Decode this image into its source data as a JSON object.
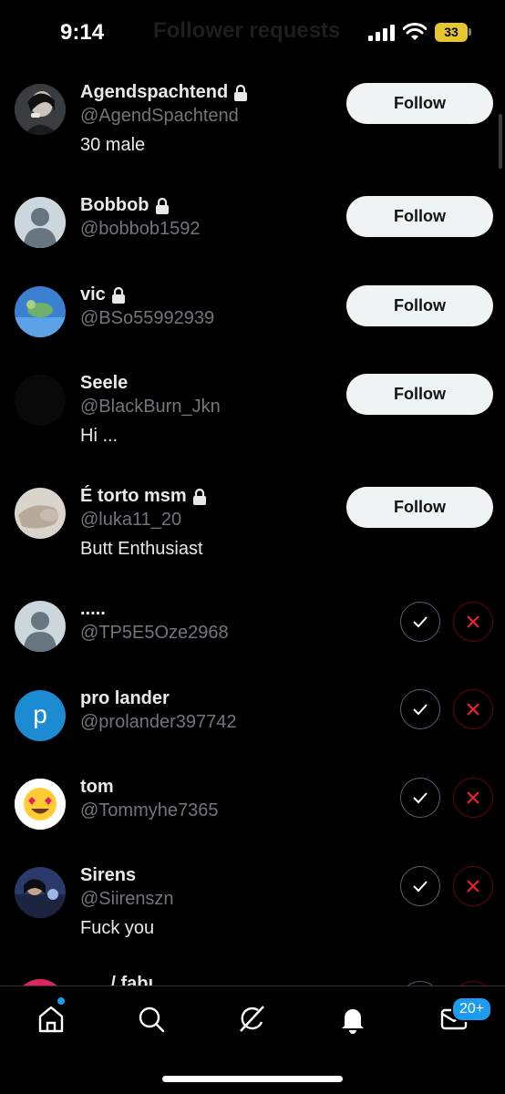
{
  "status_bar": {
    "time": "9:14",
    "battery": "33",
    "faded_title": "Follower requests"
  },
  "rows": [
    {
      "name": "Agendspachtend",
      "handle": "@AgendSpachtend",
      "bio": "30 male",
      "action": "Follow"
    },
    {
      "name": "Bobbob",
      "handle": "@bobbob1592",
      "bio": "",
      "action": "Follow"
    },
    {
      "name": "vic",
      "handle": "@BSo55992939",
      "bio": "",
      "action": "Follow"
    },
    {
      "name": "Seele",
      "handle": "@BlackBurn_Jkn",
      "bio": "Hi ...",
      "action": "Follow"
    },
    {
      "name": "É torto msm",
      "handle": "@luka11_20",
      "bio": "Butt Enthusiast",
      "action": "Follow"
    },
    {
      "name": ".....",
      "handle": "@TP5E5Oze2968",
      "bio": ""
    },
    {
      "name": "pro lander",
      "handle": "@prolander397742",
      "bio": "",
      "avatar_letter": "p"
    },
    {
      "name": "tom",
      "handle": "@Tommyhe7365",
      "bio": ""
    },
    {
      "name": "Sirens",
      "handle": "@Siirenszn",
      "bio": "Fuck you"
    }
  ],
  "partial_row": {
    "name": "..... / fabı"
  },
  "tab_bar": {
    "items": [
      "home-icon",
      "search-icon",
      "grok-icon",
      "notifications-icon",
      "messages-icon"
    ],
    "messages_badge": "20+"
  },
  "colors": {
    "accent": "#1d9bf0",
    "reject": "#f4212e",
    "follow_bg": "#eff3f4"
  }
}
